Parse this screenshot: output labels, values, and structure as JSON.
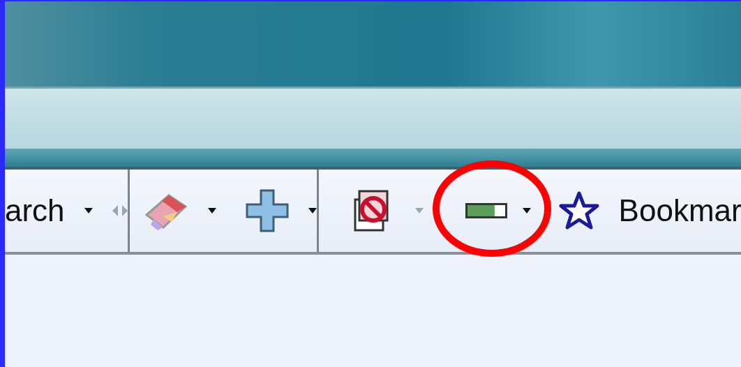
{
  "toolbar": {
    "items": [
      {
        "kind": "search",
        "label": "arch"
      },
      {
        "kind": "separator"
      },
      {
        "kind": "eraser"
      },
      {
        "kind": "plus"
      },
      {
        "kind": "separator"
      },
      {
        "kind": "popup-blocker"
      },
      {
        "kind": "meter",
        "level": 0.72,
        "highlight": true
      },
      {
        "kind": "bookmarks",
        "label": "Bookmar"
      }
    ]
  }
}
